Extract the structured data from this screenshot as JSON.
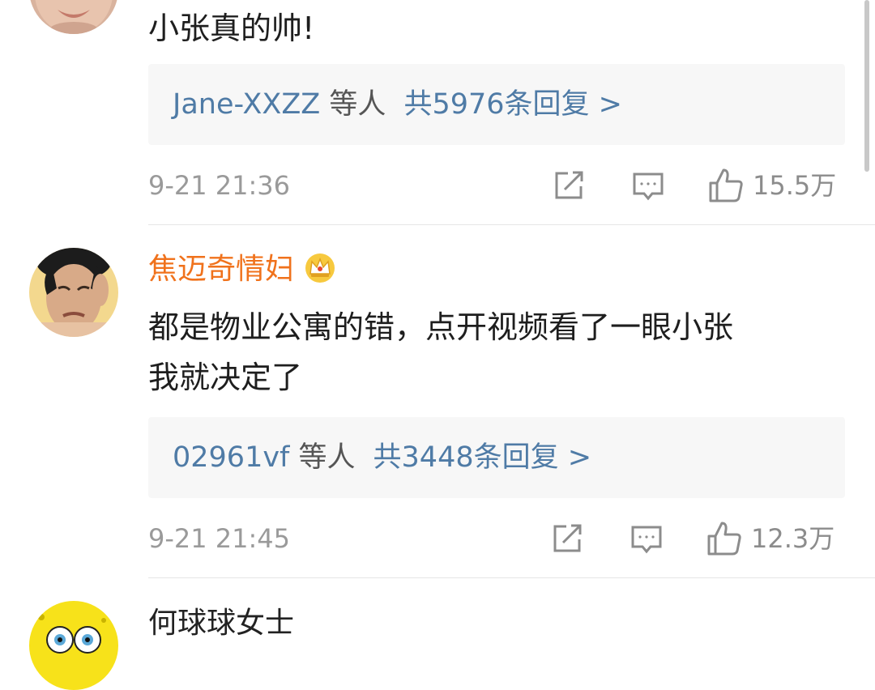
{
  "comments": [
    {
      "username": "",
      "text_lines": [
        "小张真的帅!"
      ],
      "replies": {
        "users": "Jane-XXZZ",
        "users_suffix": "等人",
        "total": "共5976条回复 >"
      },
      "time": "9-21 21:36",
      "likes": "15.5万"
    },
    {
      "username": "焦迈奇情妇",
      "badge_icon": "crown-icon",
      "text_lines": [
        "都是物业公寓的错，点开视频看了一眼小张",
        "我就决定了"
      ],
      "replies": {
        "users": "02961vf",
        "users_suffix": "等人",
        "total": "共3448条回复 >"
      },
      "time": "9-21 21:45",
      "likes": "12.3万"
    },
    {
      "username": "何球球女士"
    }
  ],
  "icons": {
    "share": "share-icon",
    "comment": "comment-icon",
    "like": "thumbs-up-icon"
  },
  "colors": {
    "vip_name": "#f0721c",
    "reply_link": "#4f7ba6",
    "meta_text": "#9a9a9a",
    "reply_bg": "#f7f7f7"
  }
}
